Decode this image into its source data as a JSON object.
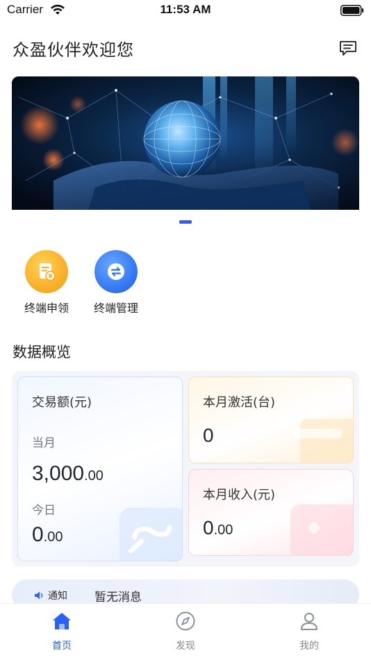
{
  "status_bar": {
    "carrier": "Carrier",
    "time": "11:53 AM"
  },
  "header": {
    "title": "众盈伙伴欢迎您",
    "message_icon": "message-icon"
  },
  "banner": {
    "image_icon": "banner-image",
    "page_count": 1,
    "current_page": 1
  },
  "quick_actions": [
    {
      "label": "终端申领",
      "icon": "document-apply-icon",
      "color": "#f7a81c"
    },
    {
      "label": "终端管理",
      "icon": "transfer-icon",
      "color": "#2a6ff0"
    }
  ],
  "overview": {
    "section_title": "数据概览",
    "trade": {
      "title": "交易额(元)",
      "month_label": "当月",
      "month_int": "3,000",
      "month_dec": ".00",
      "today_label": "今日",
      "today_int": "0",
      "today_dec": ".00"
    },
    "activation": {
      "title": "本月激活(台)",
      "value": "0"
    },
    "income": {
      "title": "本月收入(元)",
      "value_int": "0",
      "value_dec": ".00"
    }
  },
  "notice": {
    "label": "通知",
    "text": "暂无消息"
  },
  "tabbar": {
    "items": [
      {
        "label": "首页",
        "icon": "home-icon",
        "active": true
      },
      {
        "label": "发现",
        "icon": "compass-icon",
        "active": false
      },
      {
        "label": "我的",
        "icon": "user-icon",
        "active": false
      }
    ]
  },
  "colors": {
    "accent": "#2b62f5",
    "text": "#1f2430"
  }
}
